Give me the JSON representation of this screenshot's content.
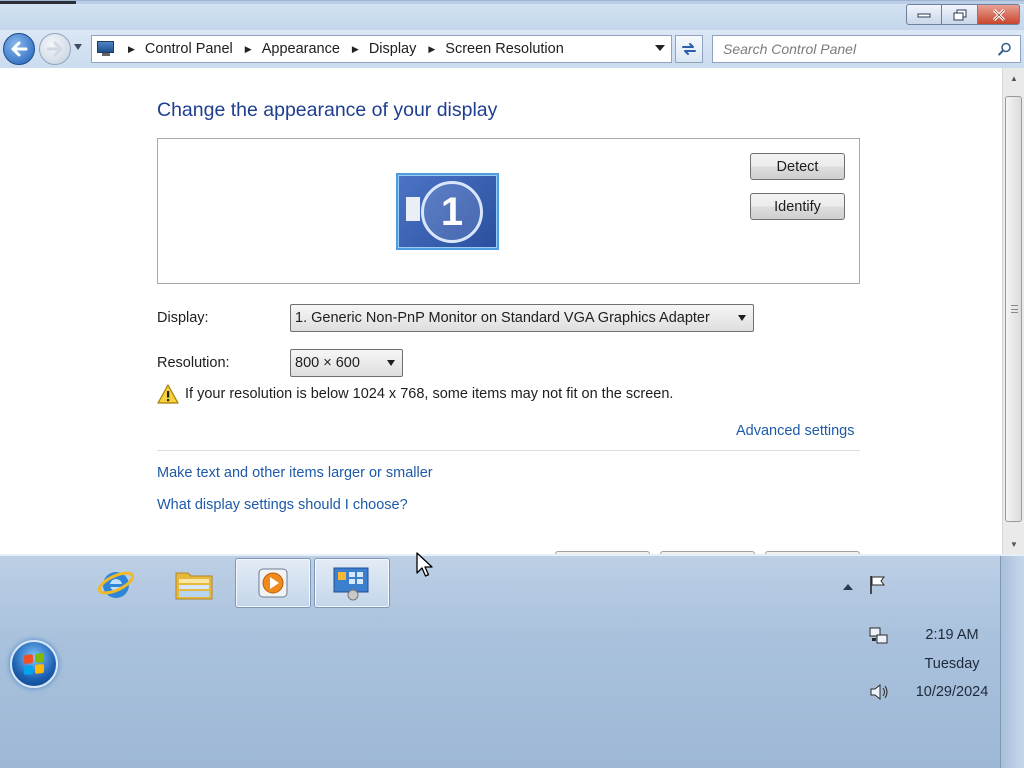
{
  "window": {
    "controls": {
      "minimize_icon": "minimize-icon",
      "maximize_icon": "restore-icon",
      "close_icon": "close-icon"
    }
  },
  "navigation": {
    "back_icon": "back-arrow-icon",
    "forward_icon": "forward-arrow-icon",
    "breadcrumbs": [
      "Control Panel",
      "Appearance",
      "Display",
      "Screen Resolution"
    ],
    "search_placeholder": "Search Control Panel"
  },
  "main": {
    "title": "Change the appearance of your display",
    "monitor_label": "1",
    "detect_label": "Detect",
    "identify_label": "Identify",
    "display_label": "Display:",
    "display_value": "1. Generic Non-PnP Monitor on Standard VGA Graphics Adapter",
    "resolution_label": "Resolution:",
    "resolution_value": "800 × 600",
    "warning_text": "If your resolution is below 1024 x 768, some items may not fit on the screen.",
    "advanced_link": "Advanced settings",
    "links": [
      "Make text and other items larger or smaller",
      "What display settings should I choose?"
    ]
  },
  "taskbar": {
    "pinned": [
      "internet-explorer-icon",
      "file-explorer-icon",
      "media-player-icon",
      "control-panel-icon"
    ],
    "clock_time": "2:19 AM",
    "clock_day": "Tuesday",
    "clock_date": "10/29/2024"
  },
  "colors": {
    "title_blue": "#1e3e8f",
    "link_blue": "#1e5aa8",
    "taskbar": "#a9c1dc"
  }
}
